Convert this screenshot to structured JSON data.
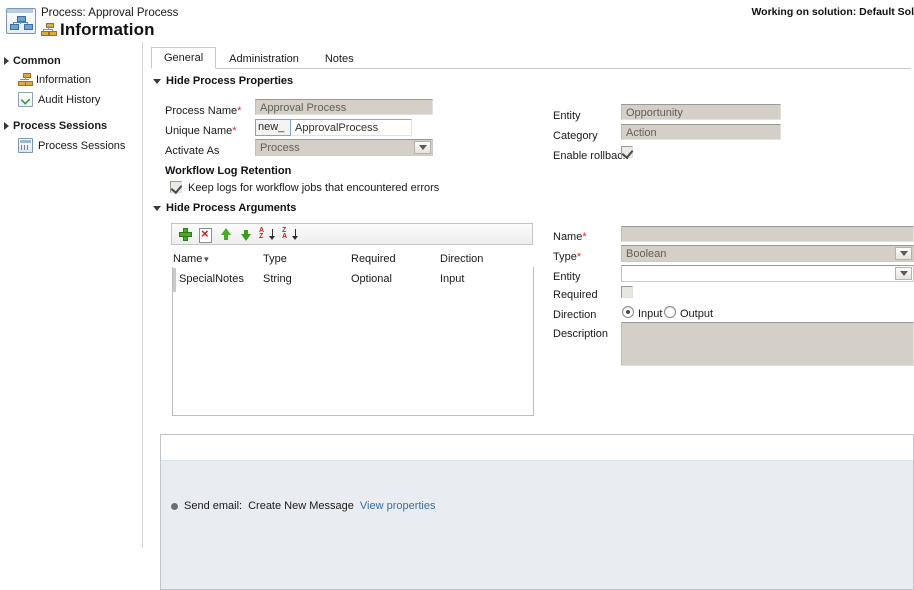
{
  "header": {
    "subtitle": "Process: Approval Process",
    "title": "Information",
    "title_icon": "process-icon",
    "solution_text": "Working on solution: Default Sol"
  },
  "sidebar": {
    "groups": [
      {
        "label": "Common",
        "items": [
          {
            "label": "Information",
            "icon": "process-node-icon"
          },
          {
            "label": "Audit History",
            "icon": "audit-history-icon"
          }
        ]
      },
      {
        "label": "Process Sessions",
        "items": [
          {
            "label": "Process Sessions",
            "icon": "process-sessions-icon"
          }
        ]
      }
    ]
  },
  "tabs": [
    {
      "label": "General",
      "active": true
    },
    {
      "label": "Administration",
      "active": false
    },
    {
      "label": "Notes",
      "active": false
    }
  ],
  "process_properties": {
    "section_label": "Hide Process Properties",
    "process_name": {
      "label": "Process Name",
      "required": true,
      "value": "Approval Process"
    },
    "unique_name": {
      "label": "Unique Name",
      "required": true,
      "prefix": "new_",
      "value": "ApprovalProcess"
    },
    "activate_as": {
      "label": "Activate As",
      "required": false,
      "value": "Process"
    },
    "entity": {
      "label": "Entity",
      "required": false,
      "value": "Opportunity"
    },
    "category": {
      "label": "Category",
      "required": false,
      "value": "Action"
    },
    "enable_rollback": {
      "label": "Enable rollback",
      "checked": true
    },
    "log_retention": {
      "heading": "Workflow Log Retention",
      "checkbox_label": "Keep logs for workflow jobs that encountered errors",
      "checked": true
    }
  },
  "process_arguments": {
    "section_label": "Hide Process Arguments",
    "toolbar": [
      {
        "name": "add-argument-button",
        "icon": "plus-icon"
      },
      {
        "name": "delete-argument-button",
        "icon": "delete-icon"
      },
      {
        "name": "move-up-button",
        "icon": "arrow-up-icon"
      },
      {
        "name": "move-down-button",
        "icon": "arrow-down-icon"
      },
      {
        "name": "sort-ascending-button",
        "icon": "sort-az-icon"
      },
      {
        "name": "sort-descending-button",
        "icon": "sort-za-icon"
      }
    ],
    "columns": [
      "Name",
      "Type",
      "Required",
      "Direction"
    ],
    "sort_indicator_column": "Name",
    "rows": [
      {
        "name": "SpecialNotes",
        "type": "String",
        "required": "Optional",
        "direction": "Input"
      }
    ],
    "detail": {
      "name": {
        "label": "Name",
        "required": true,
        "value": ""
      },
      "type": {
        "label": "Type",
        "required": true,
        "value": "Boolean"
      },
      "entity": {
        "label": "Entity",
        "required": false,
        "value": ""
      },
      "required": {
        "label": "Required",
        "checked": false
      },
      "direction": {
        "label": "Direction",
        "options": [
          {
            "label": "Input",
            "selected": true
          },
          {
            "label": "Output",
            "selected": false
          }
        ]
      },
      "description": {
        "label": "Description",
        "value": ""
      }
    }
  },
  "workflow_steps": [
    {
      "prefix": "Send email:",
      "name": "Create New Message",
      "link": "View properties"
    }
  ]
}
